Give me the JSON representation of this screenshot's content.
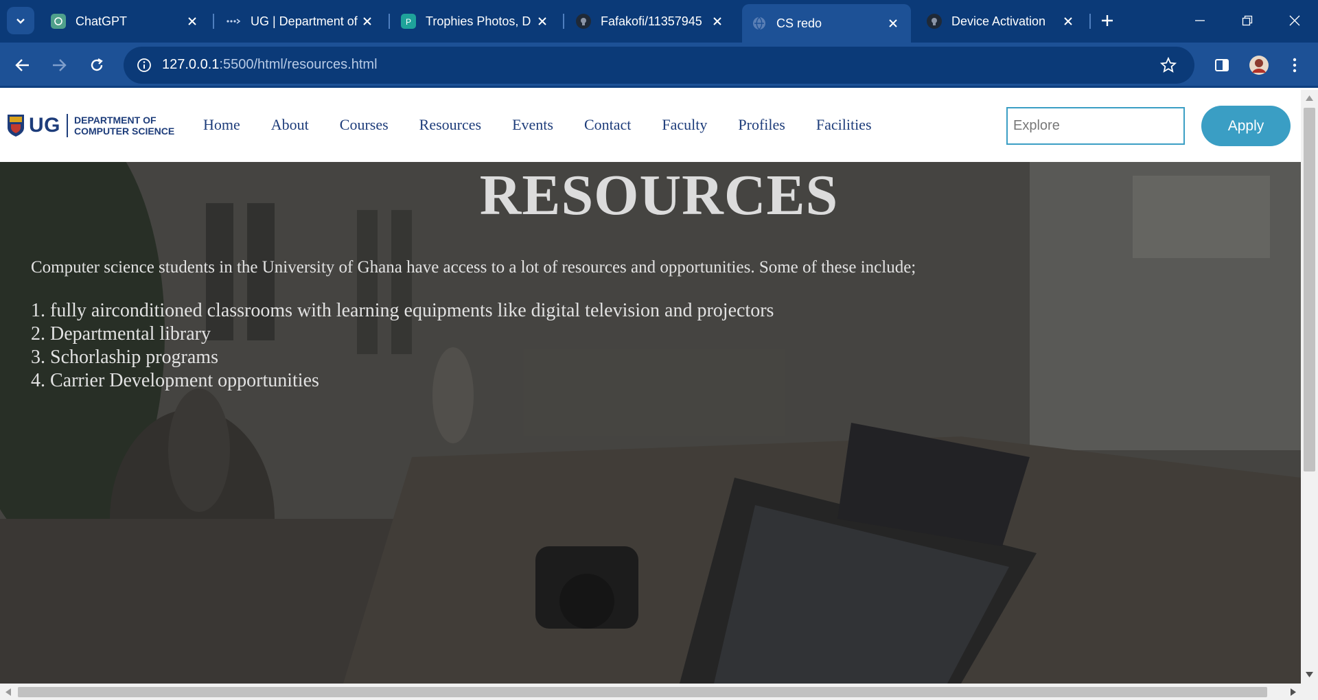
{
  "browser": {
    "tabs": [
      {
        "title": "ChatGPT",
        "icon": "chatgpt-icon"
      },
      {
        "title": "UG | Department of",
        "icon": "ug-dots-icon"
      },
      {
        "title": "Trophies Photos, D",
        "icon": "pexels-icon"
      },
      {
        "title": "Fafakofi/11357945",
        "icon": "github-icon"
      },
      {
        "title": "CS redo",
        "icon": "globe-icon",
        "active": true
      },
      {
        "title": "Device Activation",
        "icon": "github-icon"
      }
    ],
    "url_host": "127.0.0.1",
    "url_path": ":5500/html/resources.html"
  },
  "site": {
    "logo_main": "UG",
    "logo_dept_line1": "DEPARTMENT OF",
    "logo_dept_line2": "COMPUTER SCIENCE",
    "nav": [
      "Home",
      "About",
      "Courses",
      "Resources",
      "Events",
      "Contact",
      "Faculty",
      "Profiles",
      "Facilities"
    ],
    "search_placeholder": "Explore",
    "apply_label": "Apply"
  },
  "hero": {
    "title": "RESOURCES",
    "intro": "Computer science students in the University of Ghana have access to a lot of resources and opportunities. Some of these include;",
    "items": [
      "1. fully airconditioned classrooms with learning equipments like digital television and projectors",
      "2. Departmental library",
      "3. Schorlaship programs",
      "4. Carrier Development opportunities"
    ]
  },
  "colors": {
    "chrome_dark": "#0b3a78",
    "chrome": "#1d5196",
    "brand_navy": "#1d3c7a",
    "accent": "#3a9ec4"
  }
}
